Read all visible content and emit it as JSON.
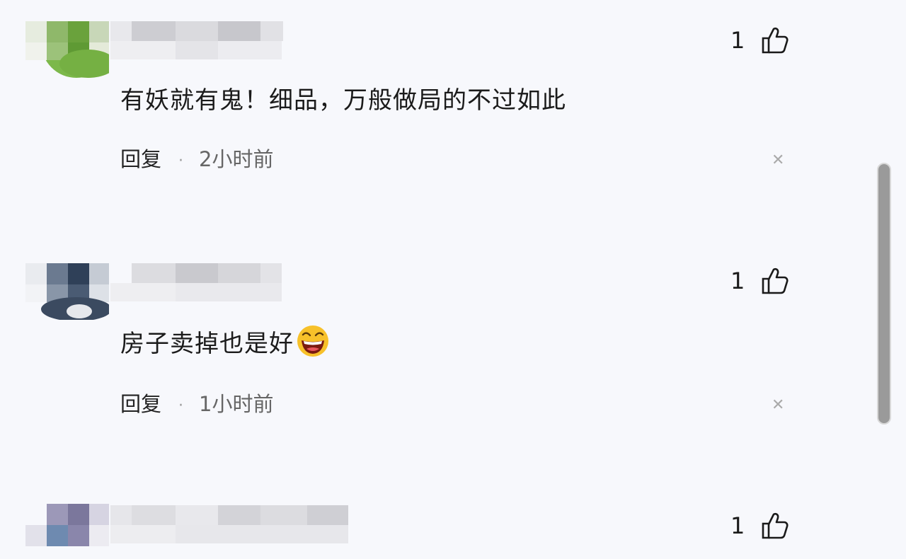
{
  "comments": [
    {
      "likes": "1",
      "text": "有妖就有鬼！细品，万般做局的不过如此",
      "reply_label": "回复",
      "separator": "·",
      "time": "2小时前"
    },
    {
      "likes": "1",
      "text": "房子卖掉也是好",
      "emoji": "laughing-face-emoji",
      "reply_label": "回复",
      "separator": "·",
      "time": "1小时前"
    },
    {
      "likes": "1"
    }
  ],
  "icons": {
    "like": "thumbs-up-icon",
    "close": "close-icon"
  },
  "colors": {
    "background": "#f7f8fc",
    "text": "#1b1b1b",
    "meta": "#666666",
    "scrollbar": "#9a9a9a"
  }
}
